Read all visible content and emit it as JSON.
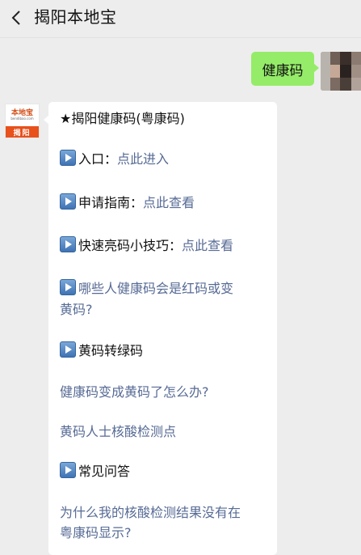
{
  "header": {
    "title": "揭阳本地宝"
  },
  "outgoing": {
    "text": "健康码"
  },
  "bot": {
    "avatar_main": "本地宝",
    "avatar_sub": "bendibao.com",
    "avatar_city": "揭阳",
    "heading": "★揭阳健康码(粤康码)",
    "items": [
      {
        "label": "入口：",
        "link": "点此进入"
      },
      {
        "label": "申请指南：",
        "link": "点此查看"
      },
      {
        "label": "快速亮码小技巧：",
        "link": "点此查看"
      }
    ],
    "red_yellow_line1": "哪些人健康码会是红码或变",
    "red_yellow_line2": "黄码?",
    "yellow_to_green": "黄码转绿码",
    "link_yellow": "健康码变成黄码了怎么办?",
    "link_test_points": "黄码人士核酸检测点",
    "faq": "常见问答",
    "faq_link_line1": "为什么我的核酸检测结果没有在",
    "faq_link_line2": "粤康码显示?"
  },
  "colors": {
    "bubble_green": "#95ec69",
    "link_blue": "#576b95",
    "bg": "#ededed"
  }
}
